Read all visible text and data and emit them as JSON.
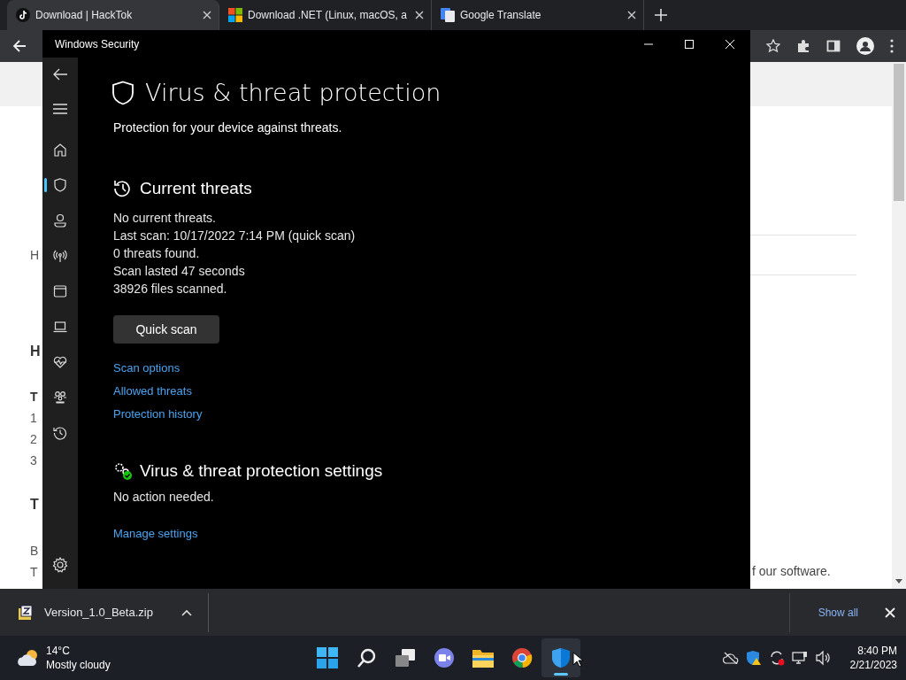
{
  "browser": {
    "tabs": [
      {
        "title": "Download | HackTok",
        "selected": true,
        "kind": "tiktok"
      },
      {
        "title": "Download .NET (Linux, macOS, a",
        "selected": false,
        "kind": "microsoft"
      },
      {
        "title": "Google Translate",
        "selected": false,
        "kind": "translate"
      }
    ],
    "page_left_fragments": [
      {
        "text": "H",
        "bold": false
      },
      {
        "text": "H",
        "bold": true
      },
      {
        "text": "T",
        "bold": true
      },
      {
        "text": "1",
        "bold": false
      },
      {
        "text": "2",
        "bold": false
      },
      {
        "text": "3",
        "bold": false
      },
      {
        "text": "T",
        "bold": true
      },
      {
        "text": "B",
        "bold": false
      },
      {
        "text": "T",
        "bold": false
      }
    ],
    "page_right_fragment": "f our software."
  },
  "window": {
    "title": "Windows Security",
    "sidebar": [
      {
        "kind": "home",
        "selected": false
      },
      {
        "kind": "shield",
        "selected": true
      },
      {
        "kind": "person",
        "selected": false
      },
      {
        "kind": "antenna",
        "selected": false
      },
      {
        "kind": "app",
        "selected": false
      },
      {
        "kind": "laptop",
        "selected": false
      },
      {
        "kind": "heart",
        "selected": false
      },
      {
        "kind": "family",
        "selected": false
      },
      {
        "kind": "history",
        "selected": false
      }
    ],
    "heading": "Virus & threat protection",
    "subtitle": "Protection for your device against threats.",
    "current_threats": {
      "title": "Current threats",
      "lines": [
        "No current threats.",
        "Last scan: 10/17/2022 7:14 PM (quick scan)",
        "0 threats found.",
        "Scan lasted 47 seconds",
        "38926 files scanned."
      ],
      "button": "Quick scan",
      "links": [
        "Scan options",
        "Allowed threats",
        "Protection history"
      ]
    },
    "settings": {
      "title": "Virus & threat protection settings",
      "status": "No action needed.",
      "link": "Manage settings"
    }
  },
  "download_bar": {
    "file": "Version_1.0_Beta.zip",
    "show_all": "Show all"
  },
  "taskbar": {
    "weather": {
      "temp": "14°C",
      "condition": "Mostly cloudy"
    },
    "apps": [
      {
        "kind": "start",
        "selected": false
      },
      {
        "kind": "search",
        "selected": false
      },
      {
        "kind": "taskview",
        "selected": false
      },
      {
        "kind": "chat",
        "selected": false
      },
      {
        "kind": "explorer",
        "selected": false
      },
      {
        "kind": "chrome",
        "selected": false
      },
      {
        "kind": "defender",
        "selected": true
      }
    ],
    "time": "8:40 PM",
    "date": "2/21/2023"
  }
}
